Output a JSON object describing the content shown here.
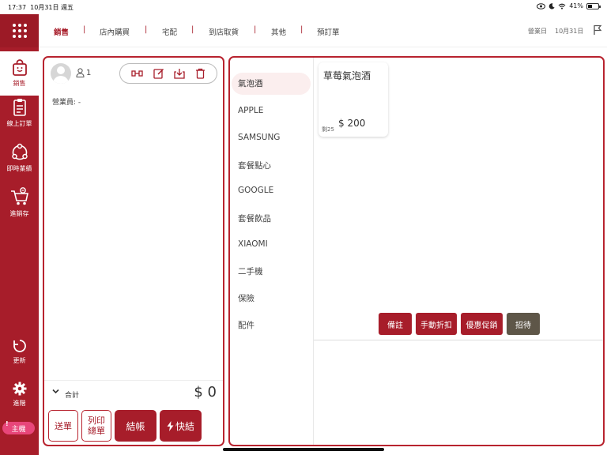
{
  "status": {
    "time": "17:37",
    "date": "10月31日 週五",
    "battery": "41%",
    "battery_level": 0.41
  },
  "sidebar": {
    "items": [
      {
        "label": "銷售",
        "icon": "shopping-bag-icon"
      },
      {
        "label": "線上訂單",
        "icon": "clipboard-list-icon"
      },
      {
        "label": "即時業績",
        "icon": "chart-circle-icon"
      },
      {
        "label": "進銷存",
        "icon": "cart-icon"
      },
      {
        "label": "更新",
        "icon": "refresh-icon"
      },
      {
        "label": "進階",
        "icon": "gear-icon"
      }
    ],
    "main_badge": "主機",
    "badge_mark": "!"
  },
  "topnav": {
    "tabs": [
      "銷售",
      "店內購買",
      "宅配",
      "到店取貨",
      "其他",
      "預訂單"
    ],
    "separator": "|",
    "business_day_label": "營業日",
    "business_day": "10月31日"
  },
  "order": {
    "guest_count": "1",
    "salesperson_label": "營業員: -",
    "total_label": "合計",
    "total_amount": "$ 0",
    "buttons": {
      "send": "送單",
      "print_l1": "列印",
      "print_l2": "總單",
      "checkout": "結帳",
      "quick": "快結"
    }
  },
  "catalog": {
    "categories": [
      "氣泡酒",
      "APPLE",
      "SAMSUNG",
      "套餐點心",
      "GOOGLE",
      "套餐飲品",
      "XIAOMI",
      "二手機",
      "保險",
      "配件"
    ],
    "selected_category": "氣泡酒",
    "products": [
      {
        "name": "草莓氣泡酒",
        "stock": "剩25",
        "price": "$ 200"
      }
    ],
    "actions": [
      "備註",
      "手動折扣",
      "優惠促銷",
      "招待"
    ]
  },
  "colors": {
    "accent": "#a71d2a",
    "action_dark": "#5e5648",
    "badge": "#e8467a"
  }
}
